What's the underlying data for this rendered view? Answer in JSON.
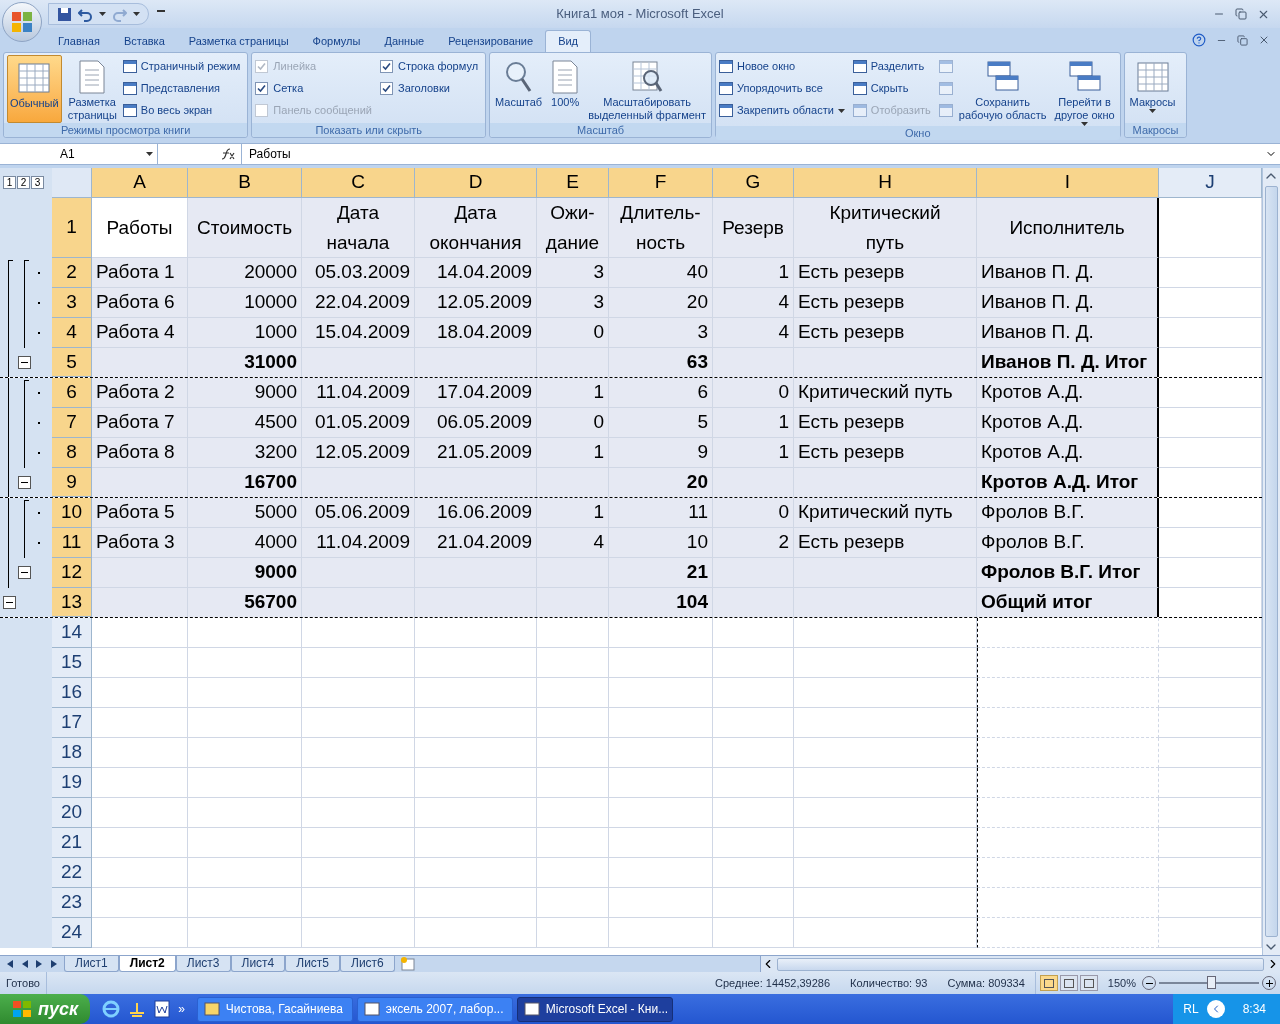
{
  "window": {
    "title": "Книга1 моя - Microsoft Excel"
  },
  "ribbon_tabs": [
    {
      "label": "Главная",
      "selected": false
    },
    {
      "label": "Вставка",
      "selected": false
    },
    {
      "label": "Разметка страницы",
      "selected": false
    },
    {
      "label": "Формулы",
      "selected": false
    },
    {
      "label": "Данные",
      "selected": false
    },
    {
      "label": "Рецензирование",
      "selected": false
    },
    {
      "label": "Вид",
      "selected": true
    }
  ],
  "ribbon_groups": [
    {
      "label": "Режимы просмотра книги",
      "items": [
        {
          "kind": "large",
          "label": "Обычный",
          "selected": true
        },
        {
          "kind": "large",
          "label": "Разметка\nстраницы",
          "selected": false
        },
        {
          "kind": "small",
          "label": "Страничный режим"
        },
        {
          "kind": "small",
          "label": "Представления"
        },
        {
          "kind": "small",
          "label": "Во весь экран"
        }
      ]
    },
    {
      "label": "Показать или скрыть",
      "items": [
        {
          "kind": "check",
          "label": "Линейка",
          "checked": true,
          "disabled": true
        },
        {
          "kind": "check",
          "label": "Сетка",
          "checked": true,
          "disabled": false
        },
        {
          "kind": "check",
          "label": "Панель сообщений",
          "checked": false,
          "disabled": true
        },
        {
          "kind": "check",
          "label": "Строка формул",
          "checked": true,
          "disabled": false
        },
        {
          "kind": "check",
          "label": "Заголовки",
          "checked": true,
          "disabled": false
        }
      ]
    },
    {
      "label": "Масштаб",
      "items": [
        {
          "kind": "large",
          "label": "Масштаб",
          "selected": false
        },
        {
          "kind": "large",
          "label": "100%",
          "selected": false
        },
        {
          "kind": "large",
          "label": "Масштабировать\nвыделенный фрагмент",
          "selected": false
        }
      ]
    },
    {
      "label": "Окно",
      "items": [
        {
          "kind": "small",
          "label": "Новое окно"
        },
        {
          "kind": "small",
          "label": "Упорядочить все"
        },
        {
          "kind": "small",
          "label": "Закрепить области",
          "has_menu": true
        },
        {
          "kind": "small",
          "label": "Разделить"
        },
        {
          "kind": "small",
          "label": "Скрыть"
        },
        {
          "kind": "small",
          "label": "Отобразить",
          "disabled": true
        },
        {
          "kind": "icon",
          "disabled": true
        },
        {
          "kind": "icon",
          "disabled": true
        },
        {
          "kind": "icon",
          "disabled": true
        },
        {
          "kind": "large",
          "label": "Сохранить\nрабочую область",
          "selected": false
        },
        {
          "kind": "large",
          "label": "Перейти в\nдругое окно",
          "selected": false,
          "has_menu": true
        }
      ]
    },
    {
      "label": "Макросы",
      "items": [
        {
          "kind": "large",
          "label": "Макросы",
          "selected": false,
          "has_menu": true
        }
      ]
    }
  ],
  "formula_bar": {
    "name_box": "A1",
    "value": "Работы"
  },
  "outline_levels": [
    "1",
    "2",
    "3"
  ],
  "columns": [
    {
      "label": "A",
      "selected": true
    },
    {
      "label": "B",
      "selected": true
    },
    {
      "label": "C",
      "selected": true
    },
    {
      "label": "D",
      "selected": true
    },
    {
      "label": "E",
      "selected": true
    },
    {
      "label": "F",
      "selected": true
    },
    {
      "label": "G",
      "selected": true
    },
    {
      "label": "H",
      "selected": true
    },
    {
      "label": "I",
      "selected": true
    },
    {
      "label": "J",
      "selected": false
    }
  ],
  "header_row": {
    "num": "1",
    "selected": true,
    "cells": [
      "Работы",
      "Стоимость",
      "Дата\nначала",
      "Дата\nокончания",
      "Ожи-\nдание",
      "Длитель-\nность",
      "Резерв",
      "Критический\nпуть",
      "Исполнитель"
    ]
  },
  "rows": [
    {
      "num": "2",
      "kind": "data",
      "selected": true,
      "page_break": false,
      "cells": [
        "Работа 1",
        "20000",
        "05.03.2009",
        "14.04.2009",
        "3",
        "40",
        "1",
        "Есть резерв",
        "Иванов П. Д."
      ]
    },
    {
      "num": "3",
      "kind": "data",
      "selected": true,
      "page_break": false,
      "cells": [
        "Работа 6",
        "10000",
        "22.04.2009",
        "12.05.2009",
        "3",
        "20",
        "4",
        "Есть резерв",
        "Иванов П. Д."
      ]
    },
    {
      "num": "4",
      "kind": "data",
      "selected": true,
      "page_break": false,
      "cells": [
        "Работа 4",
        "1000",
        "15.04.2009",
        "18.04.2009",
        "0",
        "3",
        "4",
        "Есть резерв",
        "Иванов П. Д."
      ]
    },
    {
      "num": "5",
      "kind": "subtotal",
      "selected": true,
      "page_break": true,
      "cells": [
        null,
        "31000",
        null,
        null,
        null,
        "63",
        null,
        null,
        "Иванов П. Д. Итог"
      ]
    },
    {
      "num": "6",
      "kind": "data",
      "selected": true,
      "page_break": false,
      "cells": [
        "Работа 2",
        "9000",
        "11.04.2009",
        "17.04.2009",
        "1",
        "6",
        "0",
        "Критический путь",
        "Кротов А.Д."
      ]
    },
    {
      "num": "7",
      "kind": "data",
      "selected": true,
      "page_break": false,
      "cells": [
        "Работа 7",
        "4500",
        "01.05.2009",
        "06.05.2009",
        "0",
        "5",
        "1",
        "Есть резерв",
        "Кротов А.Д."
      ]
    },
    {
      "num": "8",
      "kind": "data",
      "selected": true,
      "page_break": false,
      "cells": [
        "Работа 8",
        "3200",
        "12.05.2009",
        "21.05.2009",
        "1",
        "9",
        "1",
        "Есть резерв",
        "Кротов А.Д."
      ]
    },
    {
      "num": "9",
      "kind": "subtotal",
      "selected": true,
      "page_break": true,
      "cells": [
        null,
        "16700",
        null,
        null,
        null,
        "20",
        null,
        null,
        "Кротов А.Д. Итог"
      ]
    },
    {
      "num": "10",
      "kind": "data",
      "selected": true,
      "page_break": false,
      "cells": [
        "Работа 5",
        "5000",
        "05.06.2009",
        "16.06.2009",
        "1",
        "11",
        "0",
        "Критический путь",
        "Фролов В.Г."
      ]
    },
    {
      "num": "11",
      "kind": "data",
      "selected": true,
      "page_break": false,
      "cells": [
        "Работа 3",
        "4000",
        "11.04.2009",
        "21.04.2009",
        "4",
        "10",
        "2",
        "Есть резерв",
        "Фролов В.Г."
      ]
    },
    {
      "num": "12",
      "kind": "subtotal",
      "selected": true,
      "page_break": false,
      "cells": [
        null,
        "9000",
        null,
        null,
        null,
        "21",
        null,
        null,
        "Фролов В.Г. Итог"
      ]
    },
    {
      "num": "13",
      "kind": "total",
      "selected": true,
      "page_break": true,
      "cells": [
        null,
        "56700",
        null,
        null,
        null,
        "104",
        null,
        null,
        "Общий итог"
      ]
    }
  ],
  "empty_rows": [
    "14",
    "15",
    "16",
    "17",
    "18",
    "19",
    "20",
    "21",
    "22",
    "23",
    "24"
  ],
  "sheet_tabs": [
    {
      "label": "Лист1",
      "selected": false
    },
    {
      "label": "Лист2",
      "selected": true
    },
    {
      "label": "Лист3",
      "selected": false
    },
    {
      "label": "Лист4",
      "selected": false
    },
    {
      "label": "Лист5",
      "selected": false
    },
    {
      "label": "Лист6",
      "selected": false
    }
  ],
  "status_bar": {
    "status": "Готово",
    "stats": [
      "Среднее: 14452,39286",
      "Количество: 93",
      "Сумма: 809334"
    ],
    "views": [
      {
        "selected": true
      },
      {
        "selected": false
      },
      {
        "selected": false
      }
    ],
    "zoom": "150%",
    "zoom_slider": {
      "level": 0.52
    }
  },
  "taskbar": {
    "start": "пуск",
    "more": "»",
    "tasks": [
      {
        "label": "Чистова, Гасайниева",
        "selected": false
      },
      {
        "label": "эксель  2007, лабор...",
        "selected": false
      },
      {
        "label": "Microsoft Excel - Кни...",
        "selected": true
      }
    ],
    "language": "RL",
    "clock": "8:34"
  }
}
